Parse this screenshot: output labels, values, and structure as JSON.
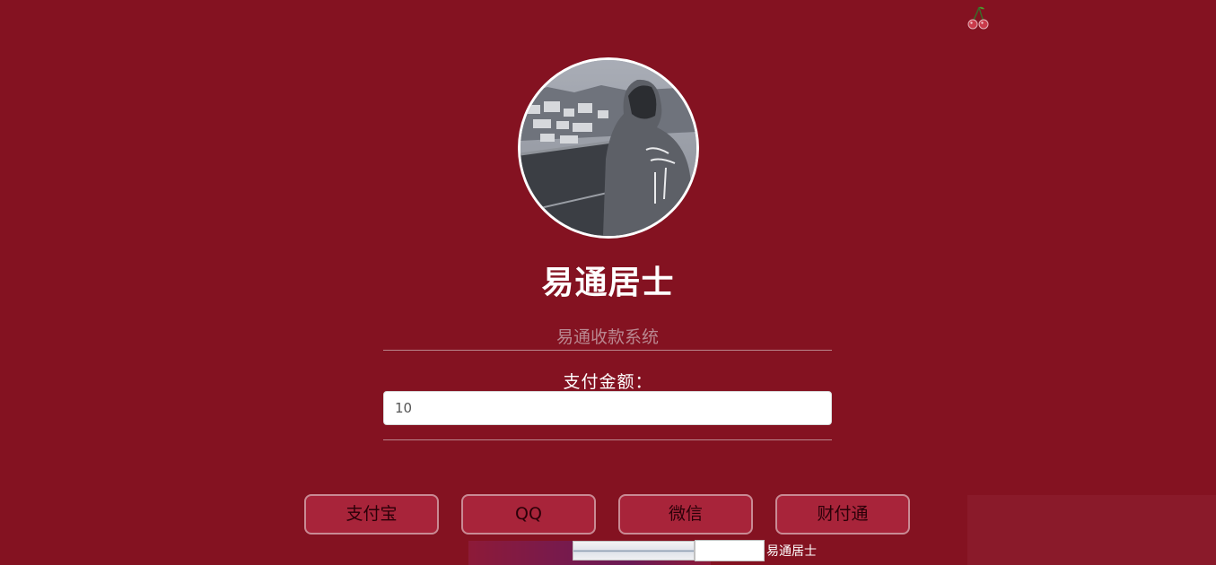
{
  "header": {
    "title": "易通居士"
  },
  "form": {
    "system_placeholder": "易通收款系统",
    "amount_label": "支付金额：",
    "amount_value": "10"
  },
  "payment_buttons": {
    "alipay": "支付宝",
    "qq": "QQ",
    "wechat": "微信",
    "tenpay": "财付通"
  },
  "footer": {
    "name": "易通居士"
  },
  "icons": {
    "decoration": "cherry-icon",
    "avatar": "avatar-photo"
  },
  "colors": {
    "background": "#841221",
    "button_fill": "#a8243a",
    "button_border": "#c98a94"
  }
}
